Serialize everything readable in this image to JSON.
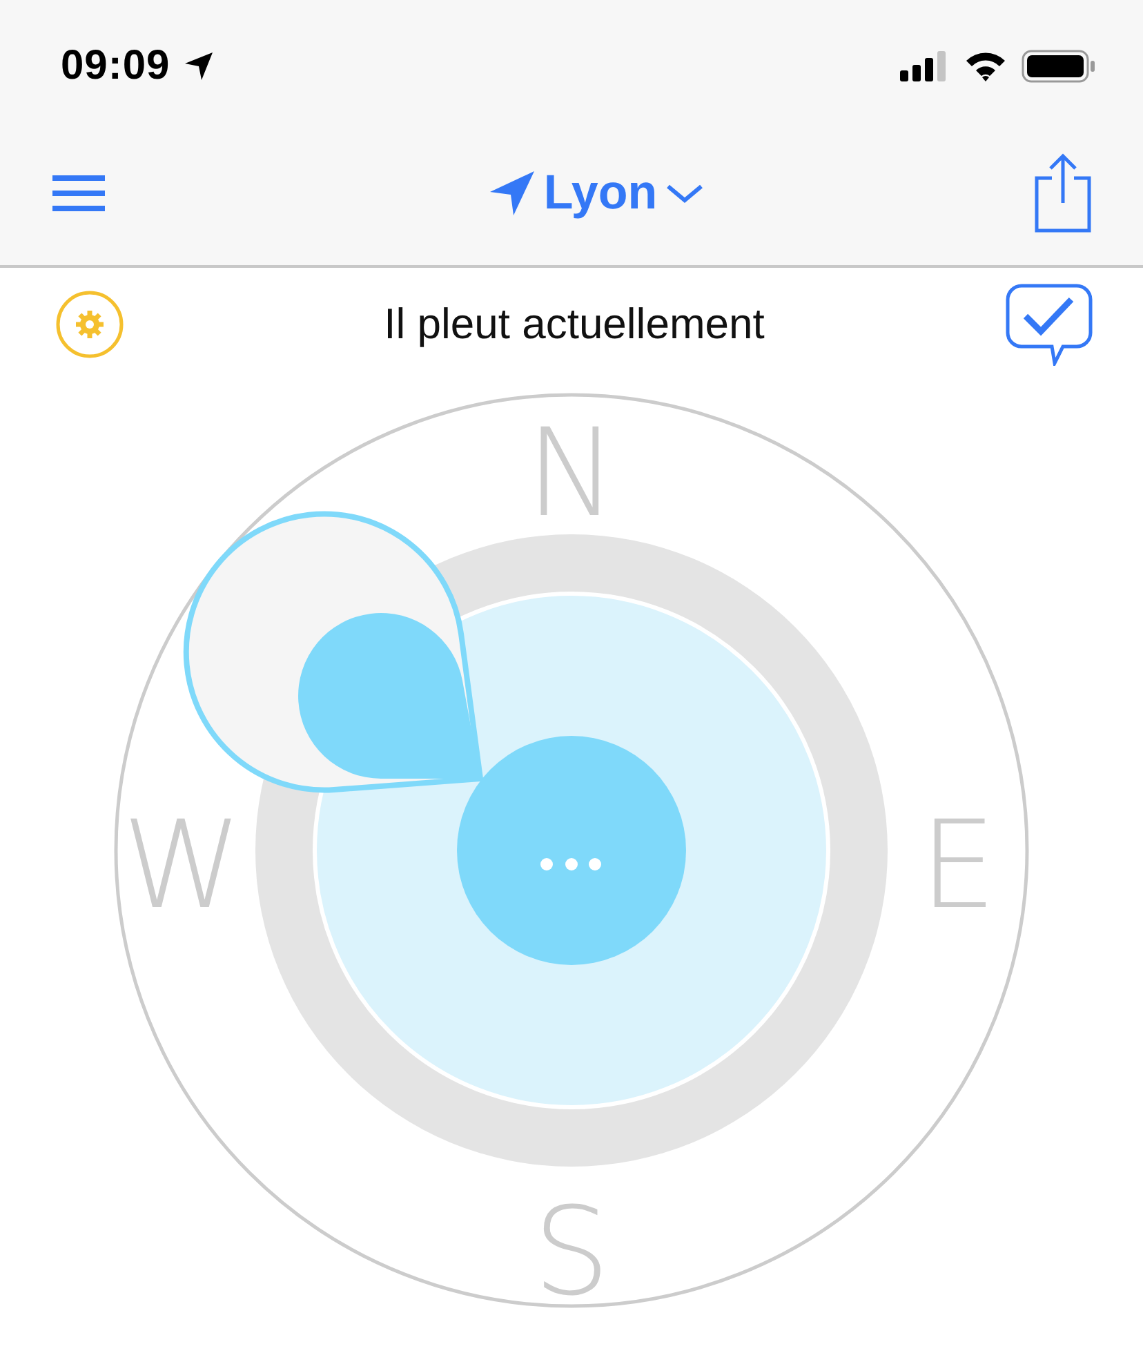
{
  "status_bar": {
    "time": "09:09"
  },
  "nav_bar": {
    "title": "Lyon"
  },
  "header": {
    "text": "Il pleut actuellement"
  },
  "compass": {
    "directions": [
      "N",
      "E",
      "S",
      "W"
    ]
  }
}
